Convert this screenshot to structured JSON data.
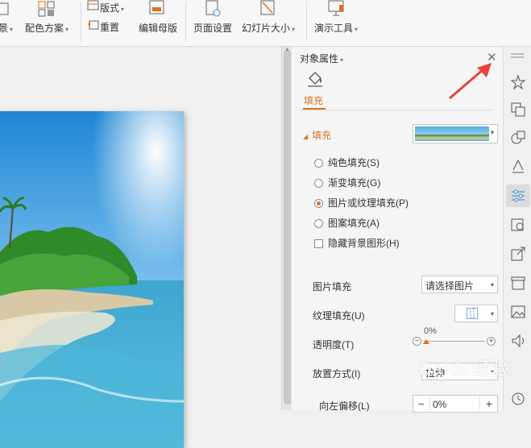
{
  "ribbon": {
    "background_label_partial": "景",
    "color_scheme_label": "配色方案",
    "layout_label": "版式",
    "reset_label": "重置",
    "edit_master_label": "编辑母版",
    "page_setup_label": "页面设置",
    "slide_size_label": "幻灯片大小",
    "presenter_tools_label": "演示工具"
  },
  "pane": {
    "title": "对象属性",
    "tab_fill_label": "填充",
    "section_fill_label": "填充",
    "fill_options": [
      {
        "label": "纯色填充(S)",
        "selected": false
      },
      {
        "label": "渐变填充(G)",
        "selected": false
      },
      {
        "label": "图片或纹理填充(P)",
        "selected": true
      },
      {
        "label": "图案填充(A)",
        "selected": false
      }
    ],
    "hide_background_label": "隐藏背景图形(H)",
    "picture_fill_label": "图片填充",
    "picture_fill_value": "请选择图片",
    "texture_fill_label": "纹理填充(U)",
    "transparency_label": "透明度(T)",
    "transparency_value": "0%",
    "placement_label": "放置方式(I)",
    "placement_value": "拉伸",
    "offset_left_label": "向左偏移(L)",
    "offset_left_value": "0%"
  },
  "rail_icons": [
    "star-magic-icon",
    "duplicate-icon",
    "shapes-icon",
    "text-style-icon",
    "properties-icon",
    "image-gallery-icon",
    "share-icon",
    "archive-icon",
    "picture-icon",
    "audio-icon",
    "history-icon"
  ],
  "watermark": "Baidu经验",
  "colors": {
    "accent": "#e0701e",
    "arrow": "#e8423a"
  }
}
